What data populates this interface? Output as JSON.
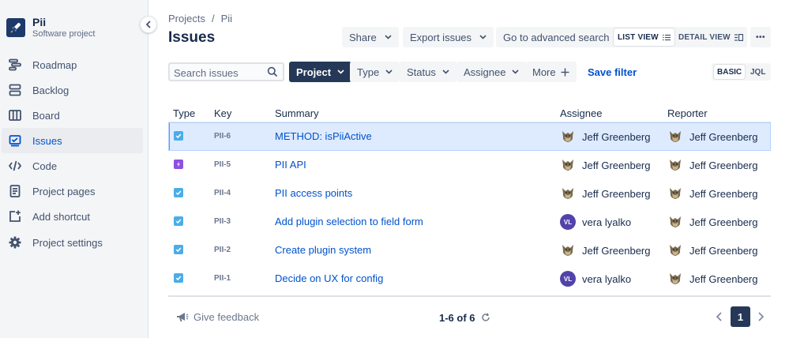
{
  "project": {
    "name": "Pii",
    "type": "Software project",
    "avatar_icon": "rocket-icon"
  },
  "sidebar": {
    "items": [
      {
        "label": "Roadmap",
        "icon": "roadmap-icon"
      },
      {
        "label": "Backlog",
        "icon": "backlog-icon"
      },
      {
        "label": "Board",
        "icon": "board-icon"
      },
      {
        "label": "Issues",
        "icon": "issues-icon",
        "active": true
      },
      {
        "label": "Code",
        "icon": "code-icon"
      },
      {
        "label": "Project pages",
        "icon": "pages-icon"
      },
      {
        "label": "Add shortcut",
        "icon": "add-shortcut-icon"
      },
      {
        "label": "Project settings",
        "icon": "gear-icon"
      }
    ]
  },
  "breadcrumb": {
    "root": "Projects",
    "sep": "/",
    "current": "Pii"
  },
  "header": {
    "title": "Issues",
    "share_label": "Share",
    "export_label": "Export issues",
    "advanced_label": "Go to advanced search",
    "list_view_label": "LIST VIEW",
    "detail_view_label": "DETAIL VIEW",
    "more_label": "•••"
  },
  "filters": {
    "search_placeholder": "Search issues",
    "project_label": "Project",
    "type_label": "Type",
    "status_label": "Status",
    "assignee_label": "Assignee",
    "more_label": "More",
    "save_filter_label": "Save filter",
    "basic_label": "BASIC",
    "jql_label": "JQL"
  },
  "table": {
    "columns": {
      "type": "Type",
      "key": "Key",
      "summary": "Summary",
      "assignee": "Assignee",
      "reporter": "Reporter"
    },
    "rows": [
      {
        "type": "task",
        "key": "PII-6",
        "summary": "METHOD: isPiiActive",
        "assignee": "Jeff Greenberg",
        "assignee_avatar": "photo",
        "reporter": "Jeff Greenberg",
        "selected": true
      },
      {
        "type": "subtask",
        "key": "PII-5",
        "summary": "PII API",
        "assignee": "Jeff Greenberg",
        "assignee_avatar": "photo",
        "reporter": "Jeff Greenberg"
      },
      {
        "type": "task",
        "key": "PII-4",
        "summary": "PII access points",
        "assignee": "Jeff Greenberg",
        "assignee_avatar": "photo",
        "reporter": "Jeff Greenberg"
      },
      {
        "type": "task",
        "key": "PII-3",
        "summary": "Add plugin selection to field form",
        "assignee": "vera lyalko",
        "assignee_avatar": "VL",
        "reporter": "Jeff Greenberg"
      },
      {
        "type": "task",
        "key": "PII-2",
        "summary": "Create plugin system",
        "assignee": "Jeff Greenberg",
        "assignee_avatar": "photo",
        "reporter": "Jeff Greenberg"
      },
      {
        "type": "task",
        "key": "PII-1",
        "summary": "Decide on UX for config",
        "assignee": "vera lyalko",
        "assignee_avatar": "VL",
        "reporter": "Jeff Greenberg"
      }
    ]
  },
  "footer": {
    "feedback_label": "Give feedback",
    "count_label": "1-6 of 6",
    "page": "1"
  },
  "colors": {
    "accent": "#0052cc",
    "dark_button": "#253858",
    "selected_row": "#deebff",
    "task": "#4bade8",
    "subtask": "#904ee2",
    "avatar_vl": "#5243aa"
  }
}
